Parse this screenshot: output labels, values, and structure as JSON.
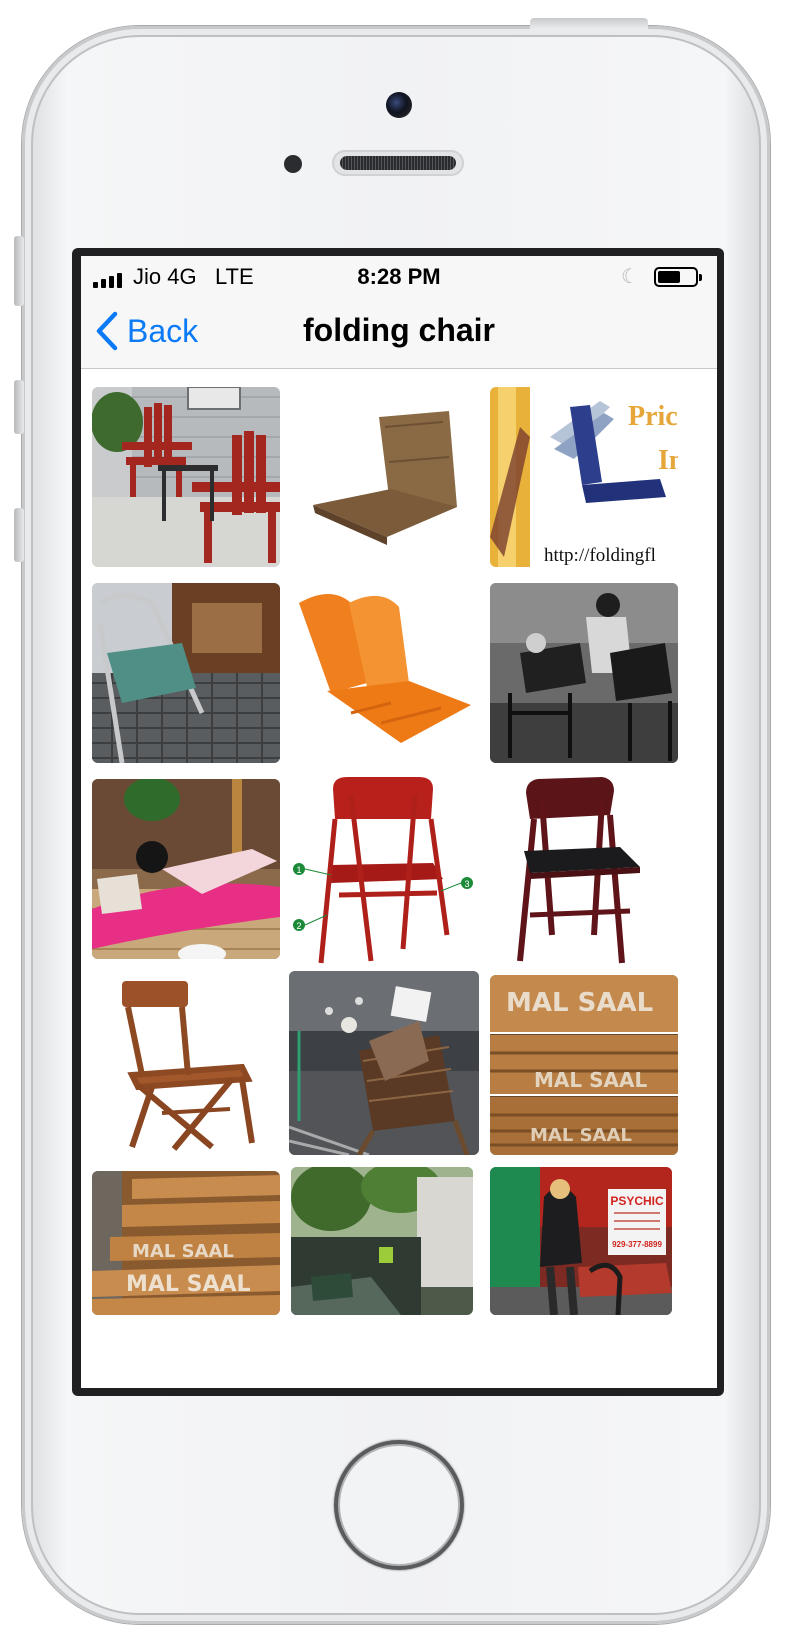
{
  "status_bar": {
    "carrier": "Jio 4G",
    "network": "LTE",
    "time": "8:28 PM",
    "battery_level": 0.6
  },
  "nav": {
    "back_label": "Back",
    "title": "folding chair"
  },
  "results": [
    {
      "name": "result-red-adirondack-chairs"
    },
    {
      "name": "result-brown-floor-chair"
    },
    {
      "name": "result-blue-folding-floor-chair-ad",
      "text_top": "Pric",
      "text_mid": "In",
      "text_url": "http://foldingfl"
    },
    {
      "name": "result-metal-folding-chair-green-cushion"
    },
    {
      "name": "result-orange-floor-chair"
    },
    {
      "name": "result-black-white-photo-directors-chairs"
    },
    {
      "name": "result-woman-on-pink-floor-cushion"
    },
    {
      "name": "result-red-metal-folding-chair-diagram",
      "labels": [
        "1",
        "2",
        "3"
      ]
    },
    {
      "name": "result-mahogany-folding-chair"
    },
    {
      "name": "result-wooden-folding-chair"
    },
    {
      "name": "result-man-reading-in-deck-chair"
    },
    {
      "name": "result-mal-saal-stacked-chairs",
      "text": "MAL SAAL"
    },
    {
      "name": "result-mal-saal-chairs-closeup",
      "text": "MAL SAAL"
    },
    {
      "name": "result-garden-patio-chair"
    },
    {
      "name": "result-psychic-reader-street",
      "sign_title": "PSYCHIC",
      "sign_phone": "929-377-8899"
    }
  ]
}
